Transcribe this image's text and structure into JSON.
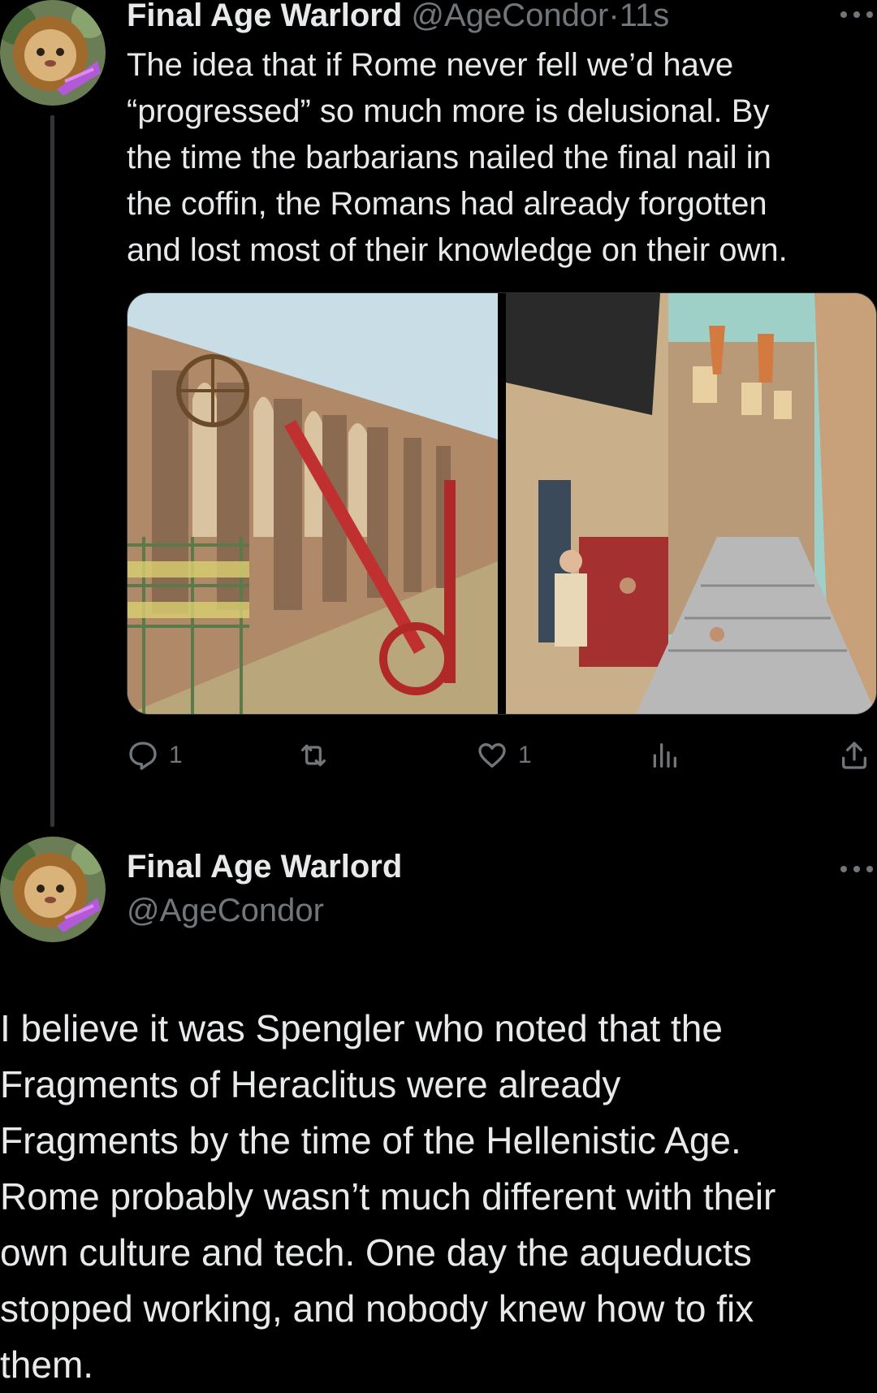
{
  "tweet1": {
    "display_name": "Final Age Warlord",
    "handle": "@AgeCondor",
    "separator": "·",
    "time": "11s",
    "text": "The idea that if Rome never fell we’d have\n“progressed” so much more is delusional. By\nthe time the barbarians nailed the final nail in\nthe coffin, the Romans had already forgotten\nand lost most of their knowledge on their own.",
    "media": [
      {
        "subject": "aqueduct-construction-illustration"
      },
      {
        "subject": "ruined-roman-street-illustration"
      }
    ],
    "actions": {
      "reply_count": "1",
      "retweet_count": "",
      "like_count": "1",
      "views_count": ""
    }
  },
  "tweet2": {
    "display_name": "Final Age Warlord",
    "handle": "@AgeCondor",
    "text": "I believe it was Spengler who noted that the\nFragments of Heraclitus were already\nFragments by the time of the Hellenistic Age.\nRome probably wasn’t much different with their\nown culture and tech. One day the aqueducts\nstopped working, and nobody knew how to fix\nthem."
  },
  "colors": {
    "background": "#000000",
    "primary_text": "#e7e9ea",
    "secondary_text": "#71767b",
    "thread_line": "#333639"
  },
  "icons": [
    "reply-icon",
    "retweet-icon",
    "like-icon",
    "views-icon",
    "share-icon",
    "more-icon"
  ]
}
